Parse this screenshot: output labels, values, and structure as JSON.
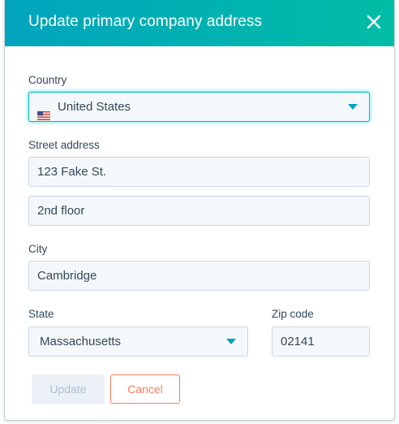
{
  "dialog": {
    "title": "Update primary company address",
    "close_icon": "close-icon"
  },
  "country": {
    "label": "Country",
    "value": "United States",
    "flag_icon": "us-flag-icon"
  },
  "street": {
    "label": "Street address",
    "line1": "123 Fake St.",
    "line2": "2nd floor"
  },
  "city": {
    "label": "City",
    "value": "Cambridge"
  },
  "state": {
    "label": "State",
    "value": "Massachusetts"
  },
  "zip": {
    "label": "Zip code",
    "value": "02141"
  },
  "actions": {
    "update_label": "Update",
    "cancel_label": "Cancel"
  },
  "colors": {
    "header_start": "#00a4bd",
    "header_end": "#00bda5",
    "accent": "#ff7a59",
    "focus": "#00bda5"
  }
}
